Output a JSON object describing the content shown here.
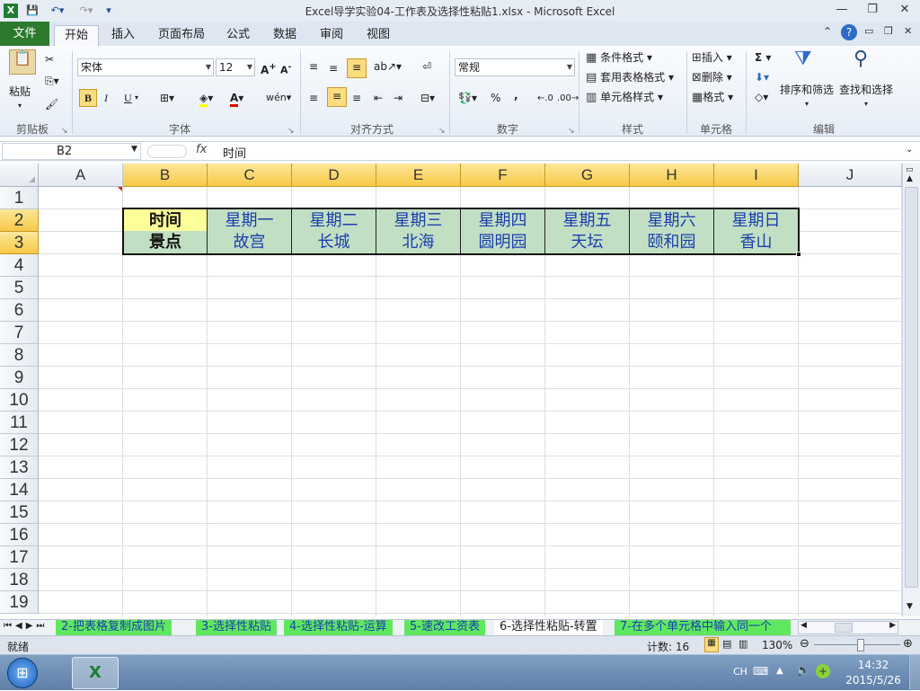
{
  "window": {
    "title": "Excel导学实验04-工作表及选择性粘贴1.xlsx - Microsoft Excel",
    "minimize": "—",
    "restore": "❐",
    "close": "✕"
  },
  "ribbon": {
    "file_tab": "文件",
    "tabs": [
      "开始",
      "插入",
      "页面布局",
      "公式",
      "数据",
      "审阅",
      "视图"
    ],
    "clipboard": {
      "paste": "粘贴",
      "group": "剪贴板"
    },
    "font": {
      "name": "宋体",
      "size": "12",
      "bold": "B",
      "italic": "I",
      "underline": "U",
      "group": "字体"
    },
    "alignment": {
      "group": "对齐方式"
    },
    "number": {
      "format": "常规",
      "percent": "%",
      "comma": ",",
      "group": "数字"
    },
    "styles": {
      "conditional": "条件格式",
      "table": "套用表格格式",
      "cell": "单元格样式",
      "group": "样式"
    },
    "cells": {
      "insert": "插入",
      "delete": "删除",
      "format": "格式",
      "group": "单元格"
    },
    "editing": {
      "sigma": "Σ",
      "sort": "排序和筛选",
      "find": "查找和选择",
      "group": "编辑"
    }
  },
  "formula_bar": {
    "name_box": "B2",
    "fx": "fx",
    "value": "时间"
  },
  "sheet": {
    "columns": [
      "A",
      "B",
      "C",
      "D",
      "E",
      "F",
      "G",
      "H",
      "I",
      "J"
    ],
    "rows": [
      "1",
      "2",
      "3",
      "4",
      "5",
      "6",
      "7",
      "8",
      "9",
      "10",
      "11",
      "12",
      "13",
      "14",
      "15",
      "16",
      "17",
      "18",
      "19"
    ],
    "selected_columns": [
      "B",
      "C",
      "D",
      "E",
      "F",
      "G",
      "H",
      "I"
    ],
    "selected_rows": [
      "2",
      "3"
    ],
    "table": {
      "header_row": [
        "时间",
        "星期一",
        "星期二",
        "星期三",
        "星期四",
        "星期五",
        "星期六",
        "星期日"
      ],
      "data_row": [
        "景点",
        "故宫",
        "长城",
        "北海",
        "圆明园",
        "天坛",
        "颐和园",
        "香山"
      ]
    },
    "colors": {
      "label_row1": "#ffff99",
      "label_row2": "#c2dfc3",
      "fill": "#c2dfc3",
      "header_text": "#1a3fb0"
    }
  },
  "sheet_tabs": [
    "2-把表格复制成图片",
    "3-选择性粘贴",
    "4-选择性粘贴-运算",
    "5-速改工资表",
    "6-选择性粘贴-转置",
    "7-在多个单元格中输入同一个"
  ],
  "active_sheet_tab": "6-选择性粘贴-转置",
  "status_bar": {
    "mode": "就绪",
    "count": "计数: 16",
    "zoom": "130%"
  },
  "taskbar": {
    "lang": "CH",
    "time": "14:32",
    "date": "2015/5/26"
  }
}
